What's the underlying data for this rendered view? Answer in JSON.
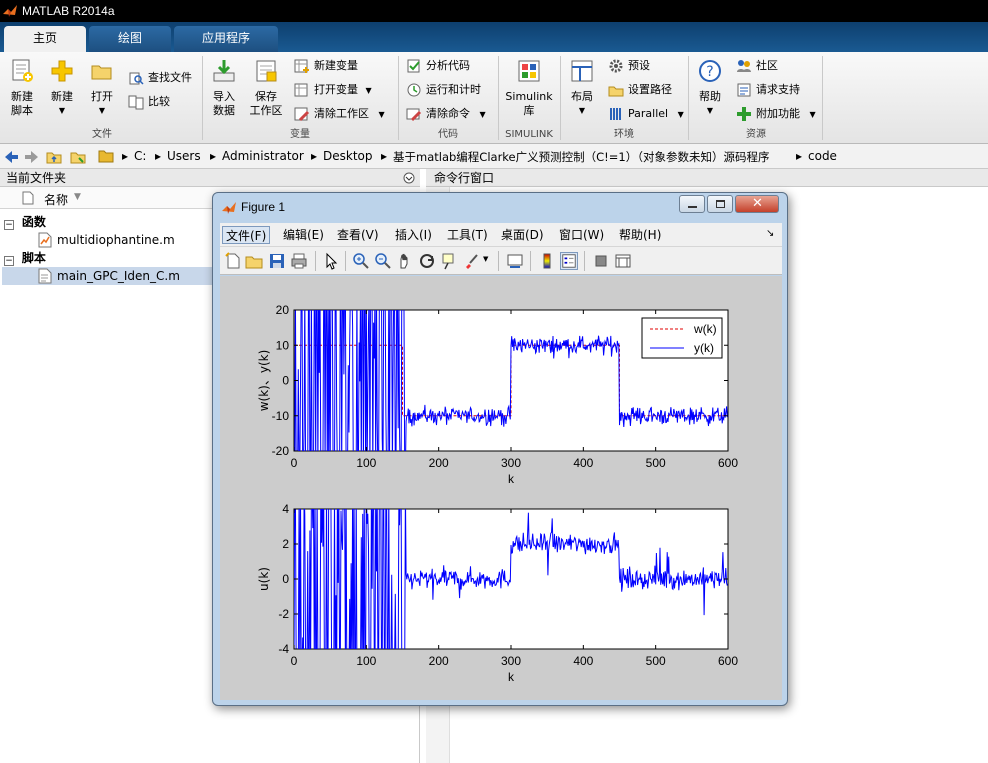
{
  "app": {
    "title": "MATLAB R2014a"
  },
  "tabs": [
    {
      "label": "主页"
    },
    {
      "label": "绘图"
    },
    {
      "label": "应用程序"
    }
  ],
  "ribbon": {
    "file": {
      "new_script": "新建\n脚本",
      "new": "新建",
      "open": "打开",
      "find_files": "查找文件",
      "compare": "比较",
      "group": "文件"
    },
    "variable": {
      "import": "导入\n数据",
      "save": "保存\n工作区",
      "new_var": "新建变量",
      "open_var": "打开变量",
      "clear_ws": "清除工作区",
      "group": "变量"
    },
    "code": {
      "analyze": "分析代码",
      "run_time": "运行和计时",
      "clear_cmd": "清除命令",
      "group": "代码"
    },
    "simulink": {
      "lib": "Simulink\n库",
      "group": "SIMULINK"
    },
    "env": {
      "layout": "布局",
      "prefs": "预设",
      "set_path": "设置路径",
      "parallel": "Parallel",
      "group": "环境"
    },
    "resources": {
      "help": "帮助",
      "community": "社区",
      "support": "请求支持",
      "addons": "附加功能",
      "group": "资源"
    }
  },
  "address": {
    "parts": [
      "C:",
      "Users",
      "Administrator",
      "Desktop",
      "基于matlab编程Clarke广义预测控制（C!=1）（对象参数未知）源码程序",
      "code"
    ]
  },
  "current_folder": {
    "title": "当前文件夹",
    "col_name": "名称",
    "groups": [
      {
        "label": "函数",
        "files": [
          "multidiophantine.m"
        ]
      },
      {
        "label": "脚本",
        "files": [
          "main_GPC_Iden_C.m"
        ]
      }
    ]
  },
  "command_window": {
    "title": "命令行窗口"
  },
  "figure": {
    "title": "Figure 1",
    "menu": [
      "文件(F)",
      "编辑(E)",
      "查看(V)",
      "插入(I)",
      "工具(T)",
      "桌面(D)",
      "窗口(W)",
      "帮助(H)"
    ]
  },
  "chart_data": [
    {
      "type": "line",
      "xlabel": "k",
      "ylabel": "w(k)、y(k)",
      "xlim": [
        0,
        600
      ],
      "ylim": [
        -20,
        20
      ],
      "xticks": [
        0,
        100,
        200,
        300,
        400,
        500,
        600
      ],
      "yticks": [
        -20,
        -10,
        0,
        10,
        20
      ],
      "legend_position": "top-right",
      "series": [
        {
          "name": "w(k)",
          "style": "dashed",
          "color": "#e00000",
          "x": [
            0,
            150,
            150,
            300,
            300,
            450,
            450,
            600
          ],
          "values": [
            10,
            10,
            -10,
            -10,
            10,
            10,
            -10,
            -10
          ]
        },
        {
          "name": "y(k)",
          "style": "solid",
          "color": "#0000ff",
          "segments": [
            {
              "x_start": 0,
              "x_end": 155,
              "behavior": "oscillating",
              "range": [
                -20,
                20
              ]
            },
            {
              "x_start": 155,
              "x_end": 300,
              "level": -10
            },
            {
              "x_start": 300,
              "x_end": 450,
              "level": 10
            },
            {
              "x_start": 450,
              "x_end": 600,
              "level": -10
            }
          ]
        }
      ]
    },
    {
      "type": "line",
      "xlabel": "k",
      "ylabel": "u(k)",
      "xlim": [
        0,
        600
      ],
      "ylim": [
        -4,
        4
      ],
      "xticks": [
        0,
        100,
        200,
        300,
        400,
        500,
        600
      ],
      "yticks": [
        -4,
        -2,
        0,
        2,
        4
      ],
      "series": [
        {
          "name": "u(k)",
          "style": "solid",
          "color": "#0000ff",
          "segments": [
            {
              "x_start": 0,
              "x_end": 155,
              "behavior": "oscillating",
              "range": [
                -4,
                4
              ]
            },
            {
              "x_start": 155,
              "x_end": 300,
              "level": 0
            },
            {
              "x_start": 300,
              "x_end": 450,
              "level": 2
            },
            {
              "x_start": 450,
              "x_end": 600,
              "level": 0
            }
          ]
        }
      ]
    }
  ]
}
